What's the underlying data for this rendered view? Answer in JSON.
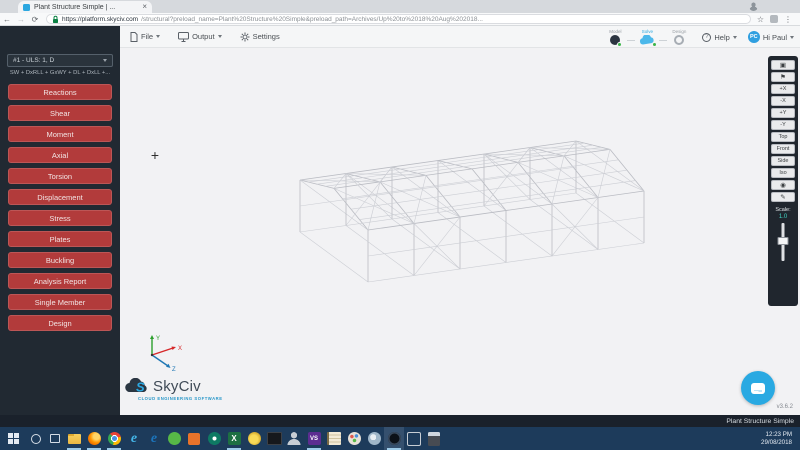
{
  "browser": {
    "tab_title": "Plant Structure Simple | ...",
    "close_glyph": "×",
    "back_glyph": "←",
    "forward_glyph": "→",
    "reload_glyph": "⟳",
    "url_host": "https://platform.skyciv.com",
    "url_path": "/structural?preload_name=Plant%20Structure%20Simple&preload_path=Archives/Up%20to%2018%20Aug%202018...",
    "star_glyph": "☆",
    "menu_glyph": "⋮"
  },
  "menubar": {
    "file": "File",
    "output": "Output",
    "settings": "Settings",
    "status": [
      {
        "label": "Model"
      },
      {
        "label": "Solve"
      },
      {
        "label": "Design"
      }
    ],
    "help": "Help",
    "help_glyph": "?",
    "avatar_initials": "PC",
    "user": "Hi Paul"
  },
  "sidebar": {
    "combo_selected": "#1 - ULS: 1, D",
    "combo_equation": "SW + DxRLL + GxWY + DL + DxLL +...",
    "buttons": [
      "Reactions",
      "Shear",
      "Moment",
      "Axial",
      "Torsion",
      "Displacement",
      "Stress",
      "Plates",
      "Buckling",
      "Analysis Report",
      "Single Member",
      "Design"
    ]
  },
  "view_toolbar": {
    "fit_glyph": "▣",
    "flag_glyph": "⚑",
    "camera_glyph": "◉",
    "annotate_glyph": "✎",
    "view_buttons": [
      "+X",
      "-X",
      "+Y",
      "-Y",
      "Top",
      "Front",
      "Side",
      "Iso"
    ],
    "scale_label": "Scale:",
    "scale_value": "1.0"
  },
  "viewport": {
    "crosshair_glyph": "+",
    "axis_labels": {
      "x": "X",
      "y": "Y",
      "z": "Z"
    },
    "brand": "SkyCiv",
    "brand_s": "S",
    "brand_sub": "CLOUD ENGINEERING SOFTWARE",
    "version": "v3.6.2"
  },
  "footer": {
    "project_title": "Plant Structure Simple"
  },
  "taskbar": {
    "time": "12:23 PM",
    "date": "29/08/2018",
    "icons": [
      {
        "name": "taskbar-icon-file-explorer",
        "cls": "tb-folder",
        "open": true
      },
      {
        "name": "taskbar-icon-firefox",
        "cls": "tb-firefox",
        "open": true
      },
      {
        "name": "taskbar-icon-chrome",
        "cls": "tb-chrome",
        "open": true
      },
      {
        "name": "taskbar-icon-internet-explorer",
        "cls": "tb-ie",
        "glyph": "e"
      },
      {
        "name": "taskbar-icon-edge",
        "cls": "tb-edge",
        "glyph": "e"
      },
      {
        "name": "taskbar-icon-green-app",
        "cls": "tb-green"
      },
      {
        "name": "taskbar-icon-orange-app",
        "cls": "tb-orange"
      },
      {
        "name": "taskbar-icon-dark-green-app",
        "cls": "tb-dkgreen"
      },
      {
        "name": "taskbar-icon-excel",
        "cls": "tb-excel",
        "glyph": "X",
        "open": true
      },
      {
        "name": "taskbar-icon-yellow-app",
        "cls": "tb-yellow"
      },
      {
        "name": "taskbar-icon-terminal",
        "cls": "tb-cmd"
      },
      {
        "name": "taskbar-icon-contacts-app",
        "cls": "tb-user"
      },
      {
        "name": "taskbar-icon-visual-studio",
        "cls": "tb-vs",
        "glyph": "VS",
        "open": true
      },
      {
        "name": "taskbar-icon-notebook-app",
        "cls": "tb-note"
      },
      {
        "name": "taskbar-icon-palette-app",
        "cls": "tb-palette"
      },
      {
        "name": "taskbar-icon-cloud-app",
        "cls": "tb-swirl"
      },
      {
        "name": "taskbar-icon-active-app",
        "cls": "tb-active-app",
        "open": true,
        "active": true
      },
      {
        "name": "taskbar-icon-square-app",
        "cls": "tb-square"
      },
      {
        "name": "taskbar-icon-calculator",
        "cls": "tb-calc"
      }
    ]
  },
  "colors": {
    "accent_red": "#b23b3b",
    "sidebar_bg": "#212932",
    "solve_blue": "#2da8e0",
    "scale_teal": "#41d6c5",
    "chat_blue": "#29a9e2",
    "taskbar_bg": "#1d3b5b",
    "wireframe_gray": "#c3c5cb"
  }
}
